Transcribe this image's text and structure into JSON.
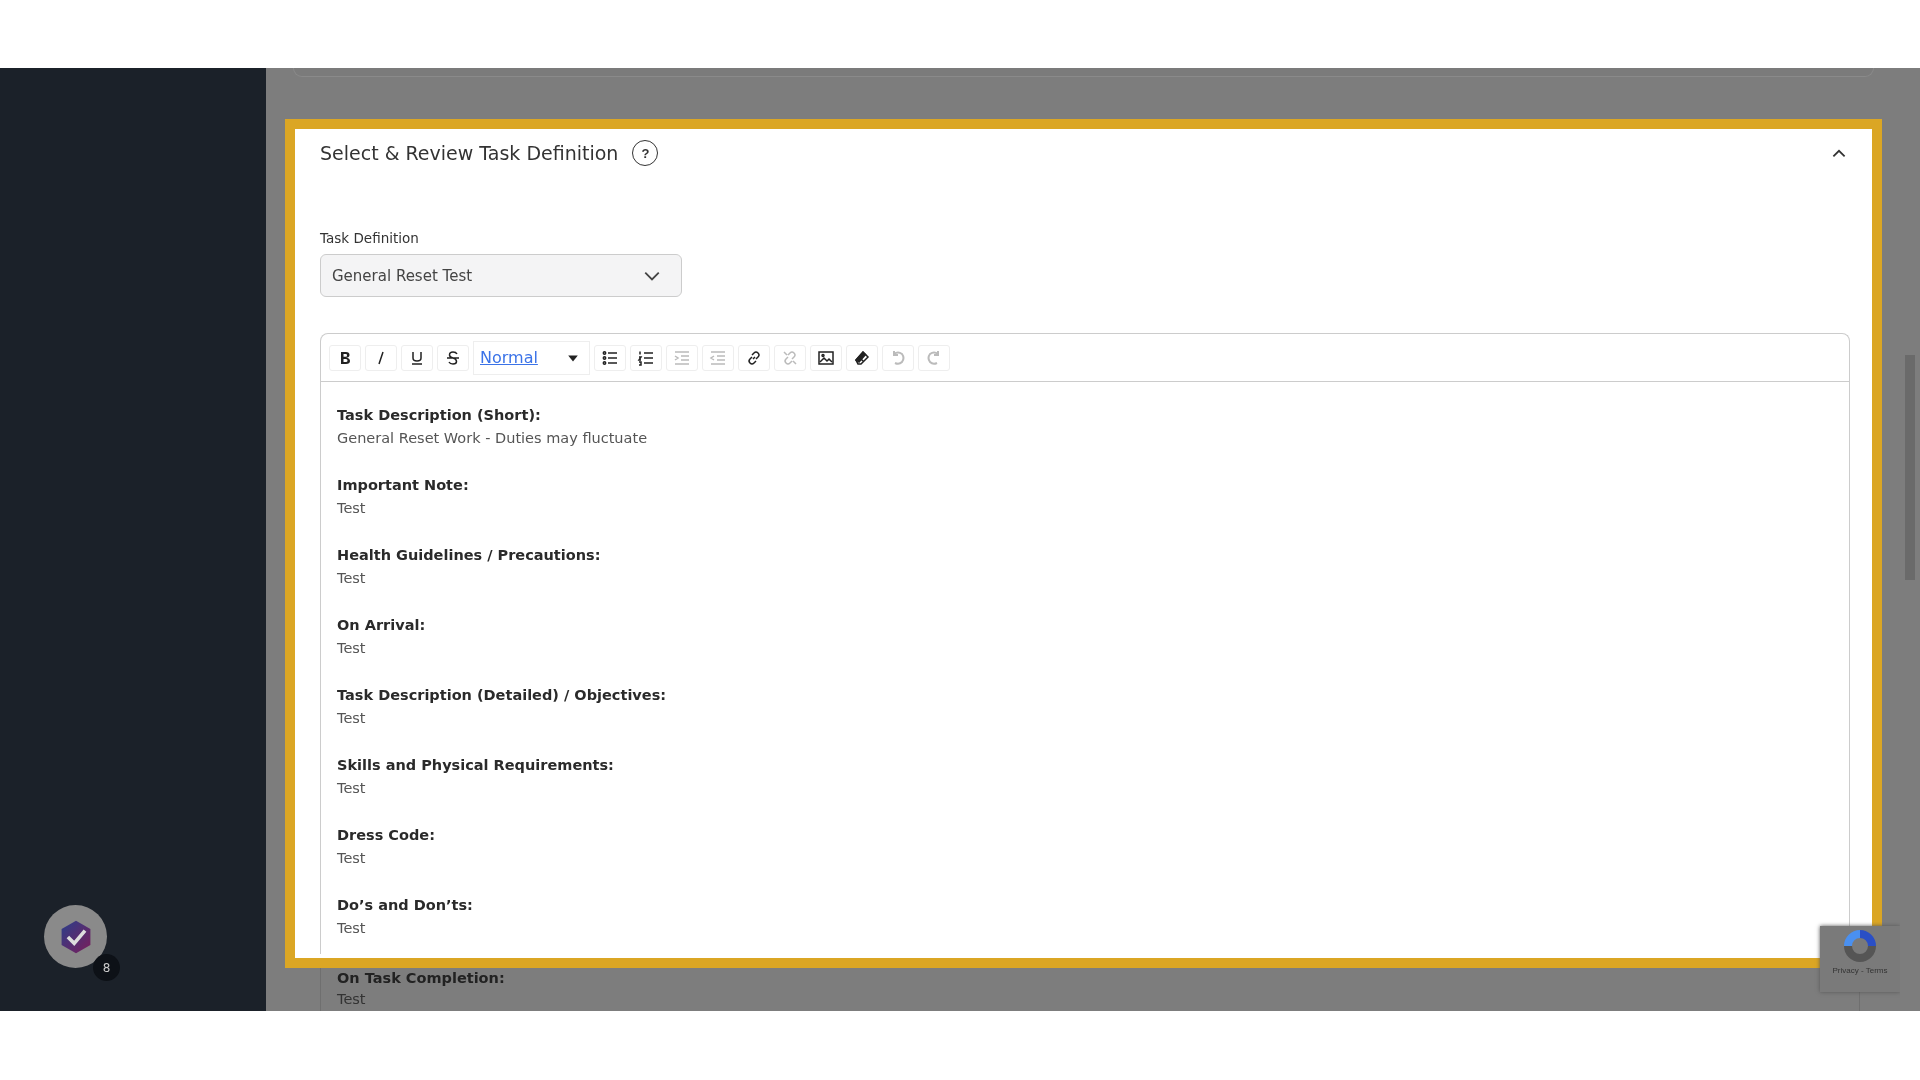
{
  "panel": {
    "title": "Select & Review Task Definition",
    "help_icon": "?",
    "expanded": true
  },
  "field": {
    "label": "Task Definition",
    "value": "General Reset Test"
  },
  "toolbar": [
    {
      "kind": "bold",
      "disabled": false
    },
    {
      "kind": "italic",
      "disabled": false
    },
    {
      "kind": "underline",
      "disabled": false
    },
    {
      "kind": "strike",
      "disabled": false
    },
    {
      "kind": "format",
      "label": "Normal"
    },
    {
      "kind": "bullets",
      "disabled": false
    },
    {
      "kind": "numbers",
      "disabled": false
    },
    {
      "kind": "indent",
      "disabled": true
    },
    {
      "kind": "outdent",
      "disabled": true
    },
    {
      "kind": "link",
      "disabled": false
    },
    {
      "kind": "unlink",
      "disabled": true
    },
    {
      "kind": "image",
      "disabled": false
    },
    {
      "kind": "eraser",
      "disabled": false
    },
    {
      "kind": "undo",
      "disabled": true
    },
    {
      "kind": "redo",
      "disabled": true
    }
  ],
  "sections": [
    {
      "heading": "Task Description (Short):",
      "value": "General Reset Work - Duties may fluctuate",
      "highlighted": true
    },
    {
      "heading": "Important Note:",
      "value": "Test",
      "highlighted": true
    },
    {
      "heading": "Health Guidelines / Precautions:",
      "value": "Test",
      "highlighted": true
    },
    {
      "heading": "On Arrival:",
      "value": "Test",
      "highlighted": true
    },
    {
      "heading": "Task Description (Detailed) / Objectives:",
      "value": "Test",
      "highlighted": true
    },
    {
      "heading": "Skills and Physical Requirements:",
      "value": "Test",
      "highlighted": true
    },
    {
      "heading": "Dress Code:",
      "value": "Test",
      "highlighted": true
    },
    {
      "heading": "Do’s and Don’ts:",
      "value": "Test",
      "highlighted": true
    },
    {
      "heading": "On Task Completion:",
      "value": "Test",
      "highlighted": false
    }
  ],
  "assistant": {
    "badge": "8"
  },
  "recaptcha": {
    "links": "Privacy - Terms"
  }
}
